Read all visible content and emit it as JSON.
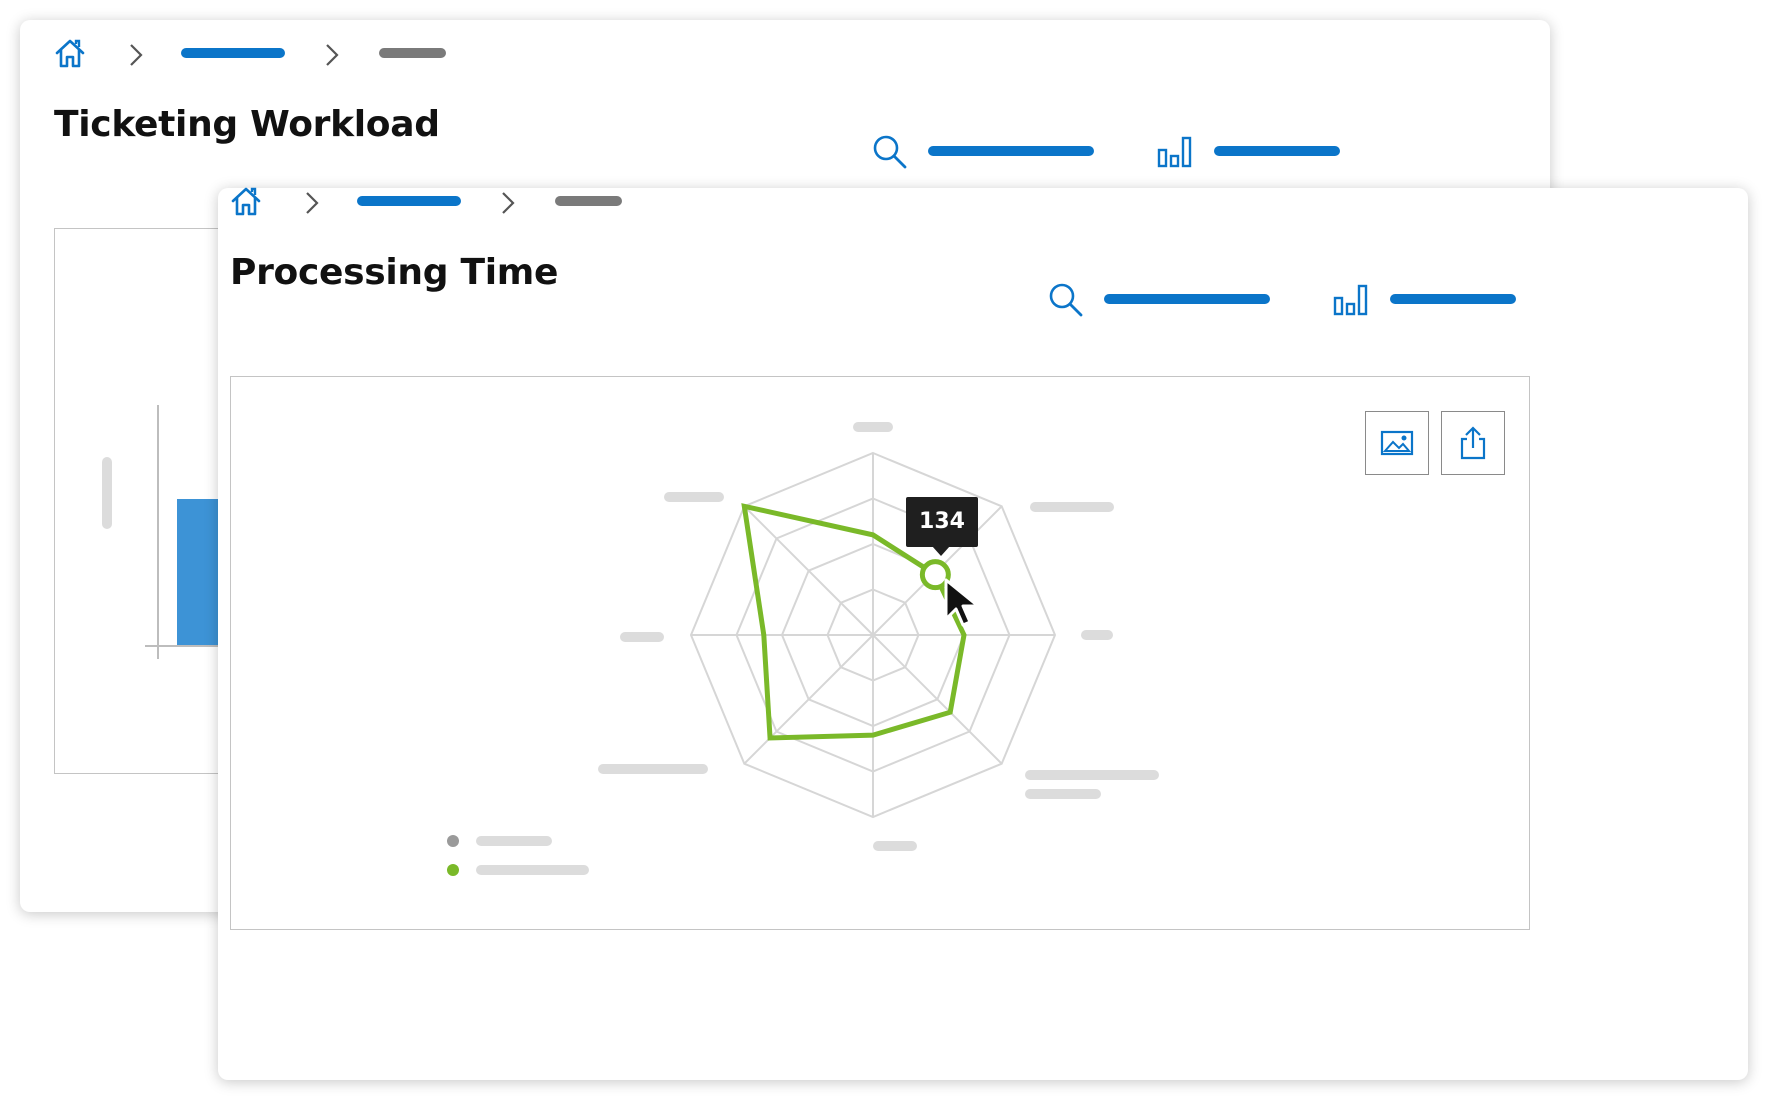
{
  "colors": {
    "accent": "#0b75c9",
    "series_green": "#7ab929",
    "grid": "#d6d6d6",
    "bar_blue": "#3d93d6"
  },
  "back_window": {
    "title": "Ticketing Workload",
    "icons": [
      "home-icon",
      "chevron-right-icon",
      "search-icon",
      "bar-chart-icon"
    ]
  },
  "front_window": {
    "title": "Processing Time",
    "icons": [
      "home-icon",
      "chevron-right-icon",
      "search-icon",
      "bar-chart-icon",
      "image-icon",
      "share-icon",
      "cursor-icon"
    ],
    "tooltip_value": "134"
  },
  "chart_data": {
    "type": "radar",
    "axes_count": 8,
    "rings": 4,
    "series": [
      {
        "values": [
          0.55,
          0.5,
          0.5,
          0.6,
          0.55,
          0.8,
          0.6,
          0.5,
          1.0
        ]
      }
    ],
    "highlighted_point_value": 134
  }
}
